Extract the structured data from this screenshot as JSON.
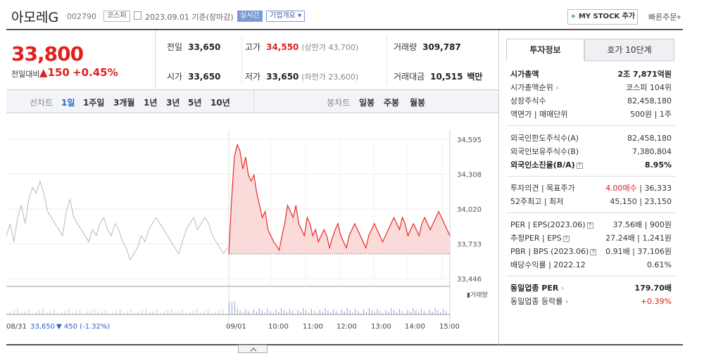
{
  "header": {
    "company": "아모레G",
    "code": "002790",
    "market_badge": "코스피",
    "date": "2023.09.01",
    "date_note": "기준(장마감)",
    "realtime": "실시간",
    "company_info": "기업개요",
    "mystock_label": "MY STOCK 추가",
    "quick_order": "빠른주문"
  },
  "price": {
    "current": "33,800",
    "change_label": "전일대비",
    "change": "150",
    "change_pct": "+0.45%"
  },
  "stats": {
    "prev_label": "전일",
    "prev": "33,650",
    "high_label": "고가",
    "high": "34,550",
    "upper_limit": "(상한가 43,700)",
    "volume_label": "거래량",
    "volume": "309,787",
    "open_label": "시가",
    "open": "33,650",
    "low_label": "저가",
    "low": "33,650",
    "lower_limit": "(하한가 23,600)",
    "amount_label": "거래대금",
    "amount": "10,515",
    "amount_unit": "백만"
  },
  "chart_tabs": {
    "line_label": "선차트",
    "periods": [
      "1일",
      "1주일",
      "3개월",
      "1년",
      "3년",
      "5년",
      "10년"
    ],
    "candle_label": "봉차트",
    "candles": [
      "일봉",
      "주봉",
      "월봉"
    ]
  },
  "chart_data": {
    "type": "line",
    "ylim": [
      33446,
      34595
    ],
    "yticks": [
      "34,595",
      "34,308",
      "34,020",
      "33,733",
      "33,446"
    ],
    "xticks": [
      "09/01",
      "10:00",
      "11:00",
      "12:00",
      "13:00",
      "14:00",
      "15:00"
    ],
    "volume_label": "거래량",
    "prev_day_label": "08/31",
    "prev_day_close": "33,650",
    "prev_day_change": "▼ 450 (-1.32%)",
    "prev_day_series": [
      33800,
      33900,
      33750,
      33950,
      34050,
      33900,
      34100,
      34200,
      34150,
      34250,
      34150,
      34000,
      33950,
      33900,
      33850,
      33800,
      34000,
      34100,
      33950,
      33900,
      33850,
      33800,
      33750,
      33850,
      33800,
      33900,
      33950,
      33850,
      33800,
      33900,
      33850,
      33750,
      33700,
      33600,
      33650,
      33700,
      33800,
      33750,
      33850,
      33900,
      33950,
      33900,
      33850,
      33800,
      33750,
      33700,
      33650,
      33750,
      33850,
      33900,
      33950,
      33850,
      33900,
      33950,
      33900,
      33800,
      33750,
      33700,
      33650,
      33700
    ],
    "today_series": [
      33650,
      34100,
      34450,
      34550,
      34500,
      34350,
      34450,
      34300,
      34250,
      34300,
      34150,
      34050,
      33950,
      34000,
      33850,
      33800,
      33750,
      33720,
      33680,
      33800,
      33900,
      34050,
      34000,
      33950,
      34050,
      33900,
      33850,
      33800,
      33950,
      33900,
      33800,
      33850,
      33750,
      33800,
      33850,
      33800,
      33700,
      33780,
      33850,
      33900,
      33800,
      33750,
      33700,
      33800,
      33850,
      33900,
      33850,
      33800,
      33750,
      33700,
      33800,
      33850,
      33900,
      33850,
      33800,
      33750,
      33800,
      33850,
      33900,
      33950,
      33900,
      33850,
      33950,
      33900,
      33800,
      33850,
      33900,
      33850,
      33800,
      33900,
      33950,
      33900,
      33850,
      33900,
      33950,
      34000,
      33950,
      33900,
      33850,
      33800
    ]
  },
  "right_panel": {
    "tab_invest": "투자정보",
    "tab_hoga": "호가 10단계",
    "rows1": [
      {
        "l": "시가총액",
        "r": "2조 7,871억원"
      },
      {
        "l": "시가총액순위",
        "r": "코스피 104위"
      },
      {
        "l": "상장주식수",
        "r": "82,458,180"
      },
      {
        "l": "액면가 | 매매단위",
        "r": "500원 | 1주"
      }
    ],
    "rows2": [
      {
        "l": "외국인한도주식수(A)",
        "r": "82,458,180"
      },
      {
        "l": "외국인보유주식수(B)",
        "r": "7,380,804"
      },
      {
        "l": "외국인소진율(B/A)",
        "r": "8.95%"
      }
    ],
    "rows3": [
      {
        "l": "투자의견 | 목표주가",
        "r1": "4.00매수",
        "r2": " | 36,333"
      },
      {
        "l": "52주최고 | 최저",
        "r": "45,150 | 23,150"
      }
    ],
    "rows4": [
      {
        "l": "PER | EPS(2023.06)",
        "r": "37.56배 | 900원"
      },
      {
        "l": "추정PER | EPS",
        "r": "27.24배 | 1,241원"
      },
      {
        "l": "PBR | BPS (2023.06)",
        "r": "0.91배 | 37,106원"
      },
      {
        "l": "배당수익률 | 2022.12",
        "r": "0.61%"
      }
    ],
    "rows5": [
      {
        "l": "동일업종 PER",
        "r": "179.70배"
      },
      {
        "l": "동일업종 등락률",
        "r": "+0.39%"
      }
    ]
  }
}
